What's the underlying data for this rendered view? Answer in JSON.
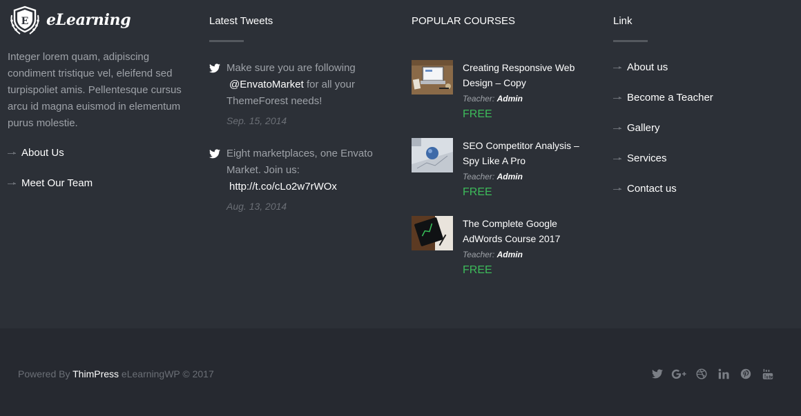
{
  "brand": {
    "logo_letter": "E",
    "name": "eLearning"
  },
  "about": {
    "text": "Integer lorem quam, adipiscing condiment tristique vel, eleifend sed turpispoliet amis. Pellentesque cursus arcu id magna euismod in elementum purus molestie.",
    "links": [
      "About Us",
      "Meet Our Team"
    ]
  },
  "tweets": {
    "title": "Latest Tweets",
    "items": [
      {
        "text_before": "Make sure you are following",
        "link": "@EnvatoMarket",
        "text_after": "for all your ThemeForest needs!",
        "date": "Sep. 15, 2014"
      },
      {
        "text_before": "Eight marketplaces, one Envato Market. Join us:",
        "link": "http://t.co/cLo2w7rWOx",
        "text_after": "",
        "date": "Aug. 13, 2014"
      }
    ]
  },
  "courses": {
    "title": "POPULAR COURSES",
    "teacher_label": "Teacher:",
    "items": [
      {
        "title": "Creating Responsive Web Design – Copy",
        "teacher": "Admin",
        "price": "FREE"
      },
      {
        "title": "SEO Competitor Analysis – Spy Like A Pro",
        "teacher": "Admin",
        "price": "FREE"
      },
      {
        "title": "The Complete Google AdWords Course 2017",
        "teacher": "Admin",
        "price": "FREE"
      }
    ]
  },
  "links": {
    "title": "Link",
    "items": [
      "About us",
      "Become a Teacher",
      "Gallery",
      "Services",
      "Contact us"
    ]
  },
  "footer": {
    "powered_by": "Powered By",
    "company": "ThimPress",
    "suffix": "eLearningWP © 2017",
    "social_icons": [
      "twitter-icon",
      "google-plus-icon",
      "dribbble-icon",
      "linkedin-icon",
      "pinterest-icon",
      "youtube-icon"
    ]
  },
  "colors": {
    "background": "#2c3037",
    "bottom_background": "#262930",
    "price": "#3dbb5a",
    "muted": "#9ea2a8"
  }
}
